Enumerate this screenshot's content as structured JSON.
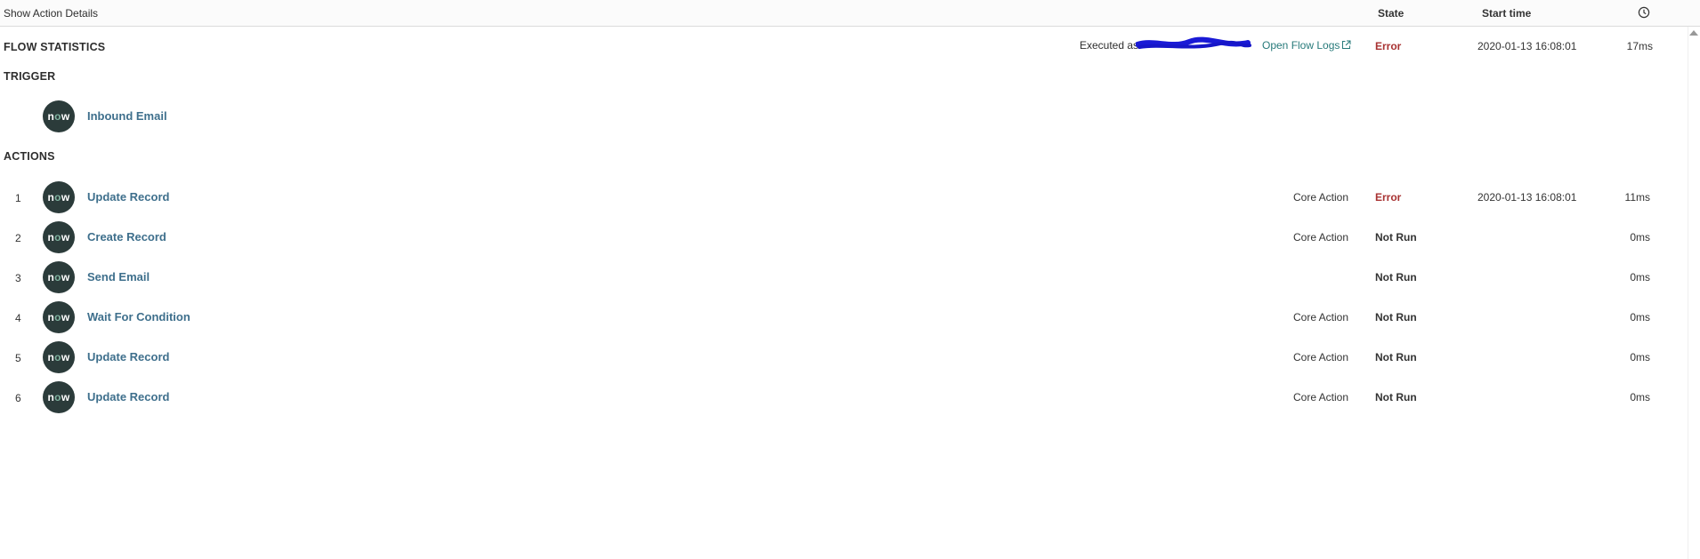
{
  "header": {
    "show_details": "Show Action Details",
    "col_state": "State",
    "col_start": "Start time",
    "duration_icon": "clock-icon"
  },
  "stats": {
    "title": "FLOW STATISTICS",
    "executed_label": "Executed as:",
    "open_logs": "Open Flow Logs",
    "state": "Error",
    "start": "2020-01-13 16:08:01",
    "duration": "17ms"
  },
  "trigger": {
    "title": "TRIGGER",
    "logo_text": "now",
    "name": "Inbound Email"
  },
  "actions": {
    "title": "ACTIONS",
    "items": [
      {
        "num": "1",
        "name": "Update Record",
        "type": "Core Action",
        "state": "Error",
        "state_kind": "error",
        "start": "2020-01-13 16:08:01",
        "duration": "11ms"
      },
      {
        "num": "2",
        "name": "Create Record",
        "type": "Core Action",
        "state": "Not Run",
        "state_kind": "notrun",
        "start": "",
        "duration": "0ms"
      },
      {
        "num": "3",
        "name": "Send Email",
        "type": "",
        "state": "Not Run",
        "state_kind": "notrun",
        "start": "",
        "duration": "0ms"
      },
      {
        "num": "4",
        "name": "Wait For Condition",
        "type": "Core Action",
        "state": "Not Run",
        "state_kind": "notrun",
        "start": "",
        "duration": "0ms"
      },
      {
        "num": "5",
        "name": "Update Record",
        "type": "Core Action",
        "state": "Not Run",
        "state_kind": "notrun",
        "start": "",
        "duration": "0ms"
      },
      {
        "num": "6",
        "name": "Update Record",
        "type": "Core Action",
        "state": "Not Run",
        "state_kind": "notrun",
        "start": "",
        "duration": "0ms"
      }
    ]
  },
  "colors": {
    "link": "#3e6f8c",
    "error": "#a83232",
    "logo_bg": "#2b3b3a",
    "open_logs": "#277a7a"
  }
}
